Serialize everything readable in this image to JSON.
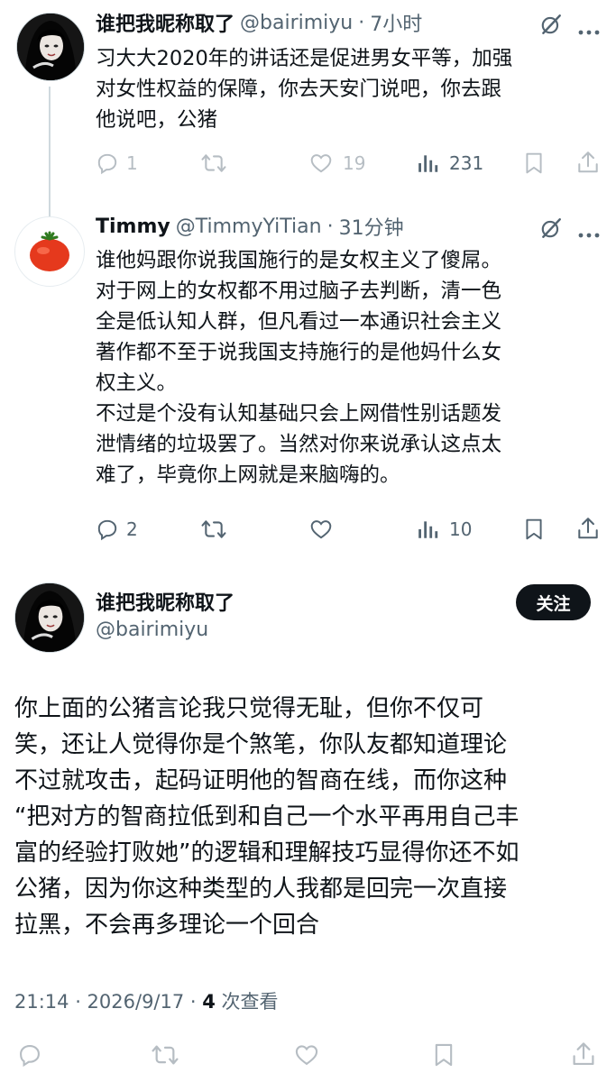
{
  "reply1": {
    "display_name": "谁把我昵称取了",
    "handle": "@bairimiyu",
    "time": "7小时",
    "lines": [
      "习大大2020年的讲话还是促进男女平等，加强",
      "对女性权益的保障，你去天安门说吧，你去跟",
      "他说吧，公猪"
    ],
    "replies": "1",
    "likes": "19",
    "views": "231",
    "icons": [
      "grok-icon",
      "more-icon",
      "reply-icon",
      "retweet-icon",
      "like-icon",
      "views-icon",
      "bookmark-icon",
      "share-icon"
    ]
  },
  "reply2": {
    "display_name": "Timmy",
    "handle": "@TimmyYiTian",
    "time": "31分钟",
    "lines": [
      "谁他妈跟你说我国施行的是女权主义了傻屌。",
      "对于网上的女权都不用过脑子去判断，清一色",
      "全是低认知人群，但凡看过一本通识社会主义",
      "著作都不至于说我国支持施行的是他妈什么女",
      "权主义。",
      "不过是个没有认知基础只会上网借性别话题发",
      "泄情绪的垃圾罢了。当然对你来说承认这点太",
      "难了，毕竟你上网就是来脑嗨的。"
    ],
    "replies": "2",
    "views": "10"
  },
  "main": {
    "display_name": "谁把我昵称取了",
    "handle": "@bairimiyu",
    "follow_label": "关注",
    "lines": [
      "你上面的公猪言论我只觉得无耻，但你不仅可",
      "笑，还让人觉得你是个煞笔，你队友都知道理论",
      "不过就攻击，起码证明他的智商在线，而你这种",
      "“把对方的智商拉低到和自己一个水平再用自己丰",
      "富的经验打败她”的逻辑和理解技巧显得你还不如",
      "公猪，因为你这种类型的人我都是回完一次直接",
      "拉黑，不会再多理论一个回合"
    ],
    "timestamp": "21:14 · 2026/9/17 · ",
    "view_count": "4",
    "view_label": " 次查看"
  },
  "colors": {
    "text": "#0f1419",
    "muted": "#536471",
    "line": "#cfd9de",
    "button": "#0f1419"
  }
}
